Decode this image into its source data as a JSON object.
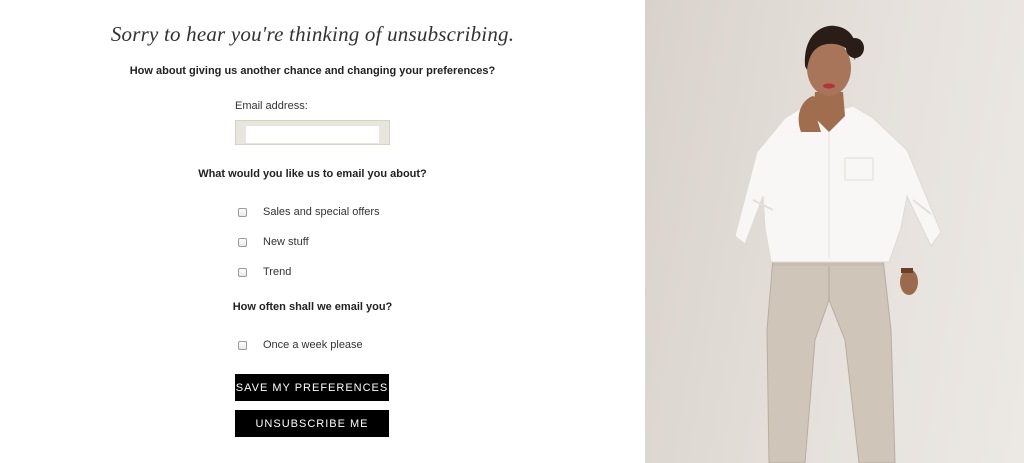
{
  "form": {
    "headline": "Sorry to hear you're thinking of unsubscribing.",
    "subhead": "How about giving us another chance and changing your preferences?",
    "email": {
      "label": "Email address:",
      "value": "",
      "placeholder": ""
    },
    "topics": {
      "question": "What would you like us to email you about?",
      "options": [
        {
          "label": "Sales and special offers",
          "checked": false
        },
        {
          "label": "New stuff",
          "checked": false
        },
        {
          "label": "Trend",
          "checked": false
        }
      ]
    },
    "frequency": {
      "question": "How often shall we email you?",
      "options": [
        {
          "label": "Once a week please",
          "checked": false
        }
      ]
    },
    "buttons": {
      "save_label": "SAVE MY PREFERENCES",
      "unsubscribe_label": "UNSUBSCRIBE ME"
    }
  },
  "colors": {
    "button_bg": "#000000",
    "button_text": "#ffffff",
    "photo_bg": "#e3ddd7",
    "email_frame": "#e7e6dc"
  }
}
